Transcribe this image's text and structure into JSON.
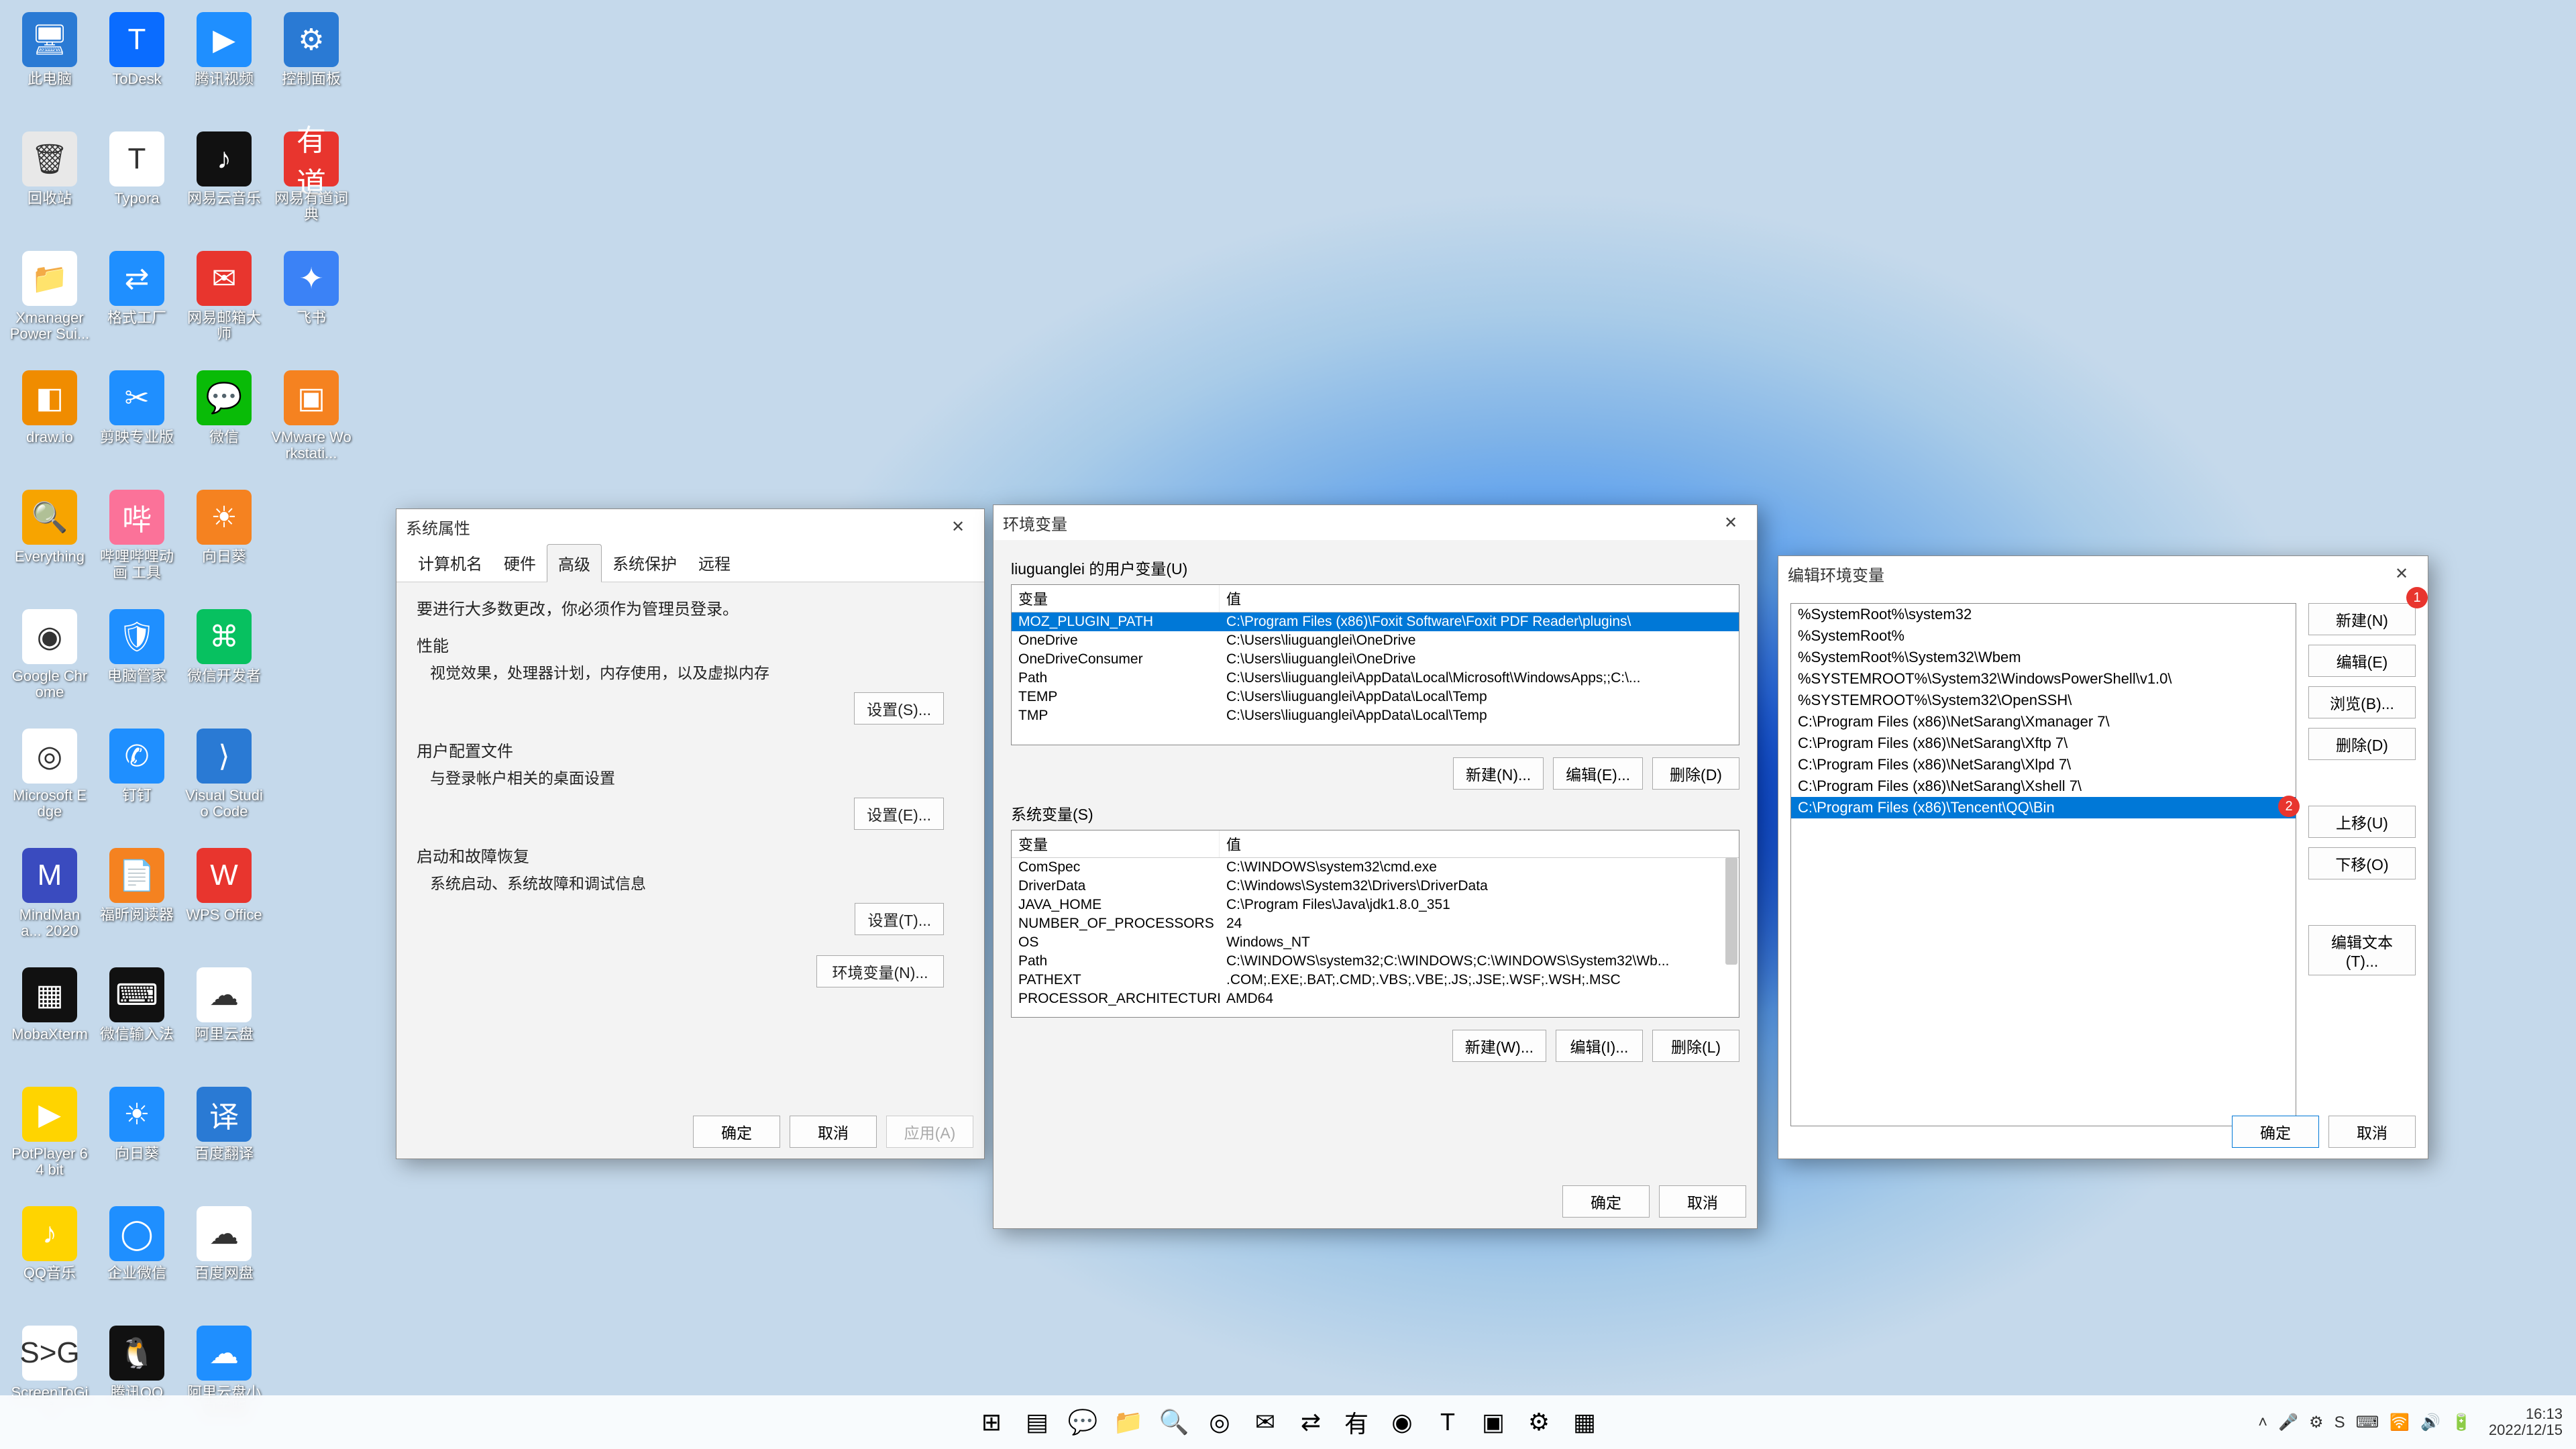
{
  "desktop_icons": [
    {
      "label": "此电脑",
      "bg": "#2a7ad4",
      "glyph": "🖥"
    },
    {
      "label": "ToDesk",
      "bg": "#0a6cff",
      "glyph": "T"
    },
    {
      "label": "腾讯视频",
      "bg": "#1f8fff",
      "glyph": "▶"
    },
    {
      "label": "控制面板",
      "bg": "#2a7ad4",
      "glyph": "⚙"
    },
    {
      "label": "回收站",
      "bg": "#e8e8e8",
      "glyph": "🗑"
    },
    {
      "label": "Typora",
      "bg": "#ffffff",
      "glyph": "T"
    },
    {
      "label": "网易云音乐",
      "bg": "#111",
      "glyph": "♪"
    },
    {
      "label": "网易有道词典",
      "bg": "#e8352e",
      "glyph": "有道"
    },
    {
      "label": "Xmanager Power Sui...",
      "bg": "#fff",
      "glyph": "📁"
    },
    {
      "label": "格式工厂",
      "bg": "#1f8fff",
      "glyph": "⇄"
    },
    {
      "label": "网易邮箱大师",
      "bg": "#e8352e",
      "glyph": "✉"
    },
    {
      "label": "飞书",
      "bg": "#3b82f6",
      "glyph": "✦"
    },
    {
      "label": "draw.io",
      "bg": "#f08c00",
      "glyph": "◧"
    },
    {
      "label": "剪映专业版",
      "bg": "#1f8fff",
      "glyph": "✂"
    },
    {
      "label": "微信",
      "bg": "#09bb07",
      "glyph": "💬"
    },
    {
      "label": "VMware Workstati...",
      "bg": "#f58220",
      "glyph": "▣"
    },
    {
      "label": "Everything",
      "bg": "#f7a400",
      "glyph": "🔍"
    },
    {
      "label": "哔哩哔哩动画 工具",
      "bg": "#fb7299",
      "glyph": "哔"
    },
    {
      "label": "向日葵",
      "bg": "#f58220",
      "glyph": "☀"
    },
    {
      "label": "",
      "bg": "transparent",
      "glyph": ""
    },
    {
      "label": "Google Chrome",
      "bg": "#fff",
      "glyph": "◉"
    },
    {
      "label": "电脑管家",
      "bg": "#1f8fff",
      "glyph": "🛡"
    },
    {
      "label": "微信开发者",
      "bg": "#07c160",
      "glyph": "⌘"
    },
    {
      "label": "",
      "bg": "transparent",
      "glyph": ""
    },
    {
      "label": "Microsoft Edge",
      "bg": "#fff",
      "glyph": "◎"
    },
    {
      "label": "钉钉",
      "bg": "#1f8fff",
      "glyph": "✆"
    },
    {
      "label": "Visual Studio Code",
      "bg": "#2a7ad4",
      "glyph": "⟩"
    },
    {
      "label": "",
      "bg": "transparent",
      "glyph": ""
    },
    {
      "label": "MindMana... 2020",
      "bg": "#3a4bbf",
      "glyph": "M"
    },
    {
      "label": "福昕阅读器",
      "bg": "#f58220",
      "glyph": "📄"
    },
    {
      "label": "WPS Office",
      "bg": "#e8352e",
      "glyph": "W"
    },
    {
      "label": "",
      "bg": "transparent",
      "glyph": ""
    },
    {
      "label": "MobaXterm",
      "bg": "#111",
      "glyph": "▦"
    },
    {
      "label": "微信输入法",
      "bg": "#111",
      "glyph": "⌨"
    },
    {
      "label": "阿里云盘",
      "bg": "#fff",
      "glyph": "☁"
    },
    {
      "label": "",
      "bg": "transparent",
      "glyph": ""
    },
    {
      "label": "PotPlayer 64 bit",
      "bg": "#ffd400",
      "glyph": "▶"
    },
    {
      "label": "向日葵",
      "bg": "#1f8fff",
      "glyph": "☀"
    },
    {
      "label": "百度翻译",
      "bg": "#2a7ad4",
      "glyph": "译"
    },
    {
      "label": "",
      "bg": "transparent",
      "glyph": ""
    },
    {
      "label": "QQ音乐",
      "bg": "#ffd400",
      "glyph": "♪"
    },
    {
      "label": "企业微信",
      "bg": "#1f8fff",
      "glyph": "◯"
    },
    {
      "label": "百度网盘",
      "bg": "#fff",
      "glyph": "☁"
    },
    {
      "label": "",
      "bg": "transparent",
      "glyph": ""
    },
    {
      "label": "ScreenToGif",
      "bg": "#fff",
      "glyph": "S>G"
    },
    {
      "label": "腾讯QQ",
      "bg": "#111",
      "glyph": "🐧"
    },
    {
      "label": "阿里云盘小白羊版",
      "bg": "#1f8fff",
      "glyph": "☁"
    },
    {
      "label": "",
      "bg": "transparent",
      "glyph": ""
    }
  ],
  "sysprops": {
    "title": "系统属性",
    "tabs": [
      "计算机名",
      "硬件",
      "高级",
      "系统保护",
      "远程"
    ],
    "active_tab_index": 2,
    "admin_note": "要进行大多数更改，你必须作为管理员登录。",
    "perf_title": "性能",
    "perf_sub": "视觉效果，处理器计划，内存使用，以及虚拟内存",
    "perf_btn": "设置(S)...",
    "profiles_title": "用户配置文件",
    "profiles_sub": "与登录帐户相关的桌面设置",
    "profiles_btn": "设置(E)...",
    "startup_title": "启动和故障恢复",
    "startup_sub": "系统启动、系统故障和调试信息",
    "startup_btn": "设置(T)...",
    "env_btn": "环境变量(N)...",
    "ok": "确定",
    "cancel": "取消",
    "apply": "应用(A)"
  },
  "env": {
    "title": "环境变量",
    "user_label": "liuguanglei 的用户变量(U)",
    "col_var": "变量",
    "col_val": "值",
    "user_rows": [
      {
        "var": "MOZ_PLUGIN_PATH",
        "val": "C:\\Program Files (x86)\\Foxit Software\\Foxit PDF Reader\\plugins\\",
        "sel": true
      },
      {
        "var": "OneDrive",
        "val": "C:\\Users\\liuguanglei\\OneDrive"
      },
      {
        "var": "OneDriveConsumer",
        "val": "C:\\Users\\liuguanglei\\OneDrive"
      },
      {
        "var": "Path",
        "val": "C:\\Users\\liuguanglei\\AppData\\Local\\Microsoft\\WindowsApps;;C:\\..."
      },
      {
        "var": "TEMP",
        "val": "C:\\Users\\liuguanglei\\AppData\\Local\\Temp"
      },
      {
        "var": "TMP",
        "val": "C:\\Users\\liuguanglei\\AppData\\Local\\Temp"
      }
    ],
    "user_new": "新建(N)...",
    "user_edit": "编辑(E)...",
    "user_del": "删除(D)",
    "sys_label": "系统变量(S)",
    "sys_rows": [
      {
        "var": "ComSpec",
        "val": "C:\\WINDOWS\\system32\\cmd.exe"
      },
      {
        "var": "DriverData",
        "val": "C:\\Windows\\System32\\Drivers\\DriverData"
      },
      {
        "var": "JAVA_HOME",
        "val": "C:\\Program Files\\Java\\jdk1.8.0_351"
      },
      {
        "var": "NUMBER_OF_PROCESSORS",
        "val": "24"
      },
      {
        "var": "OS",
        "val": "Windows_NT"
      },
      {
        "var": "Path",
        "val": "C:\\WINDOWS\\system32;C:\\WINDOWS;C:\\WINDOWS\\System32\\Wb..."
      },
      {
        "var": "PATHEXT",
        "val": ".COM;.EXE;.BAT;.CMD;.VBS;.VBE;.JS;.JSE;.WSF;.WSH;.MSC"
      },
      {
        "var": "PROCESSOR_ARCHITECTURE",
        "val": "AMD64"
      }
    ],
    "sys_new": "新建(W)...",
    "sys_edit": "编辑(I)...",
    "sys_del": "删除(L)",
    "ok": "确定",
    "cancel": "取消"
  },
  "edit": {
    "title": "编辑环境变量",
    "paths": [
      "%SystemRoot%\\system32",
      "%SystemRoot%",
      "%SystemRoot%\\System32\\Wbem",
      "%SYSTEMROOT%\\System32\\WindowsPowerShell\\v1.0\\",
      "%SYSTEMROOT%\\System32\\OpenSSH\\",
      "C:\\Program Files (x86)\\NetSarang\\Xmanager 7\\",
      "C:\\Program Files (x86)\\NetSarang\\Xftp 7\\",
      "C:\\Program Files (x86)\\NetSarang\\Xlpd 7\\",
      "C:\\Program Files (x86)\\NetSarang\\Xshell 7\\",
      "C:\\Program Files (x86)\\Tencent\\QQ\\Bin"
    ],
    "selected_index": 9,
    "btn_new": "新建(N)",
    "btn_edit": "编辑(E)",
    "btn_browse": "浏览(B)...",
    "btn_del": "删除(D)",
    "btn_up": "上移(U)",
    "btn_down": "下移(O)",
    "btn_text": "编辑文本(T)...",
    "ok": "确定",
    "cancel": "取消",
    "annot1": "1",
    "annot2": "2"
  },
  "taskbar": {
    "apps": [
      "⊞",
      "▤",
      "💬",
      "📁",
      "🔍",
      "◎",
      "✉",
      "⇄",
      "有",
      "◉",
      "T",
      "▣",
      "⚙",
      "▦"
    ]
  },
  "tray": {
    "icons": [
      "˄",
      "🎤",
      "⚙",
      "S",
      "⌨",
      "🛜",
      "🔊",
      "🔋"
    ],
    "time": "16:13",
    "date": "2022/12/15"
  }
}
